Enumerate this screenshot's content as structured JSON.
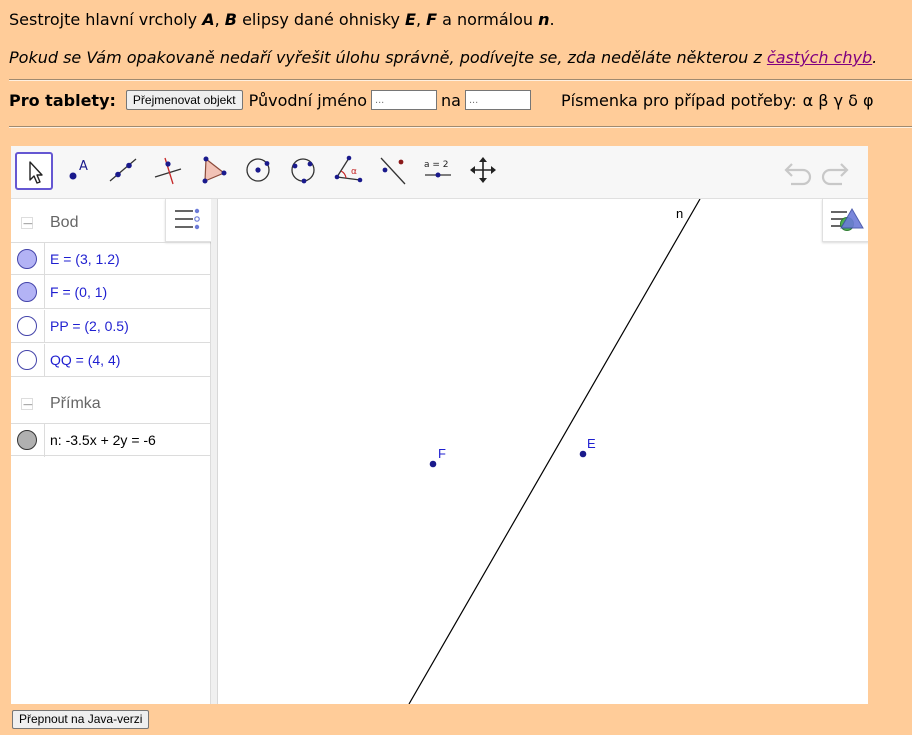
{
  "task": {
    "pre": "Sestrojte hlavní vrcholy ",
    "A": "A",
    "sep1": ", ",
    "B": "B",
    "mid": " elipsy dané ohnisky ",
    "E": "E",
    "sep2": ", ",
    "F": "F",
    "mid2": " a normálou ",
    "n": "n",
    "end": "."
  },
  "hint": {
    "pre": "Pokud se Vám opakovaně nedaří vyřešit úlohu správně, podívejte se, zda neděláte některou z ",
    "link": "častých chyb",
    "end": "."
  },
  "tablet": {
    "label": "Pro tablety:",
    "rename_button": "Přejmenovat objekt",
    "original_name_label": "Původní jméno",
    "original_placeholder": "...",
    "to_label": "na",
    "new_placeholder": "...",
    "letters_label": "Písmenka pro případ potřeby:",
    "letters": "α β γ δ φ"
  },
  "toolbar": {
    "tools": [
      "move-tool",
      "point-tool",
      "line-tool",
      "perpendicular-tool",
      "polygon-tool",
      "circle-tool",
      "conic-tool",
      "angle-tool",
      "reflect-tool",
      "slider-tool",
      "move-view-tool"
    ],
    "slider_icon_text": "a = 2",
    "point_icon_text": "A",
    "angle_icon_text": "α"
  },
  "algebra": {
    "groups": [
      {
        "name": "Bod",
        "rows": [
          {
            "def": "E = (3, 1.2)",
            "fill": "#b3b3f5"
          },
          {
            "def": "F = (0, 1)",
            "fill": "#b3b3f5"
          },
          {
            "def": "PP = (2, 0.5)",
            "fill": "#ffffff"
          },
          {
            "def": "QQ = (4, 4)",
            "fill": "#ffffff"
          }
        ]
      },
      {
        "name": "Přímka",
        "rows": [
          {
            "def": "n: -3.5x + 2y = -6",
            "fill": "#b0b0b0"
          }
        ]
      }
    ]
  },
  "graphics": {
    "labels": {
      "n": "n",
      "F": "F",
      "E": "E"
    },
    "point_color": "#1a1a8c",
    "label_color": "#1f1fd0"
  },
  "footer": {
    "java_button": "Přepnout na Java-verzi"
  }
}
